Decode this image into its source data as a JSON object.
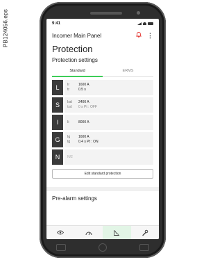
{
  "caption": "PB124056.eps",
  "status": {
    "time": "9:41"
  },
  "header": {
    "title": "Incomer Main Panel"
  },
  "page_title": "Protection",
  "settings_title": "Protection settings",
  "tabs": [
    {
      "label": "Standard",
      "active": true
    },
    {
      "label": "ERMS",
      "active": false
    }
  ],
  "rows": [
    {
      "letter": "L",
      "params": [
        {
          "name": "Ir",
          "value": "1600 A"
        },
        {
          "name": "tr",
          "value": "0.5 s"
        }
      ]
    },
    {
      "letter": "S",
      "params": [
        {
          "name": "Isd",
          "value": "2400 A"
        },
        {
          "name": "tsd",
          "value": "0 s  Pt : OFF"
        }
      ]
    },
    {
      "letter": "I",
      "params": [
        {
          "name": "Ii",
          "value": "8000 A"
        }
      ]
    },
    {
      "letter": "G",
      "params": [
        {
          "name": "Ig",
          "value": "1600 A"
        },
        {
          "name": "tg",
          "value": "0.4 s  Pt : ON"
        }
      ]
    },
    {
      "letter": "N",
      "np": "N/2"
    }
  ],
  "edit_button": "Edit standard protection",
  "pre_alarm_title": "Pre-alarm settings",
  "bottom_nav": [
    {
      "icon": "eye-icon"
    },
    {
      "icon": "gauge-icon"
    },
    {
      "icon": "curve-icon",
      "active": true
    },
    {
      "icon": "wrench-icon"
    }
  ],
  "colors": {
    "accent": "#3dcd58",
    "alert": "#e53935",
    "dark": "#3a3a3a"
  }
}
